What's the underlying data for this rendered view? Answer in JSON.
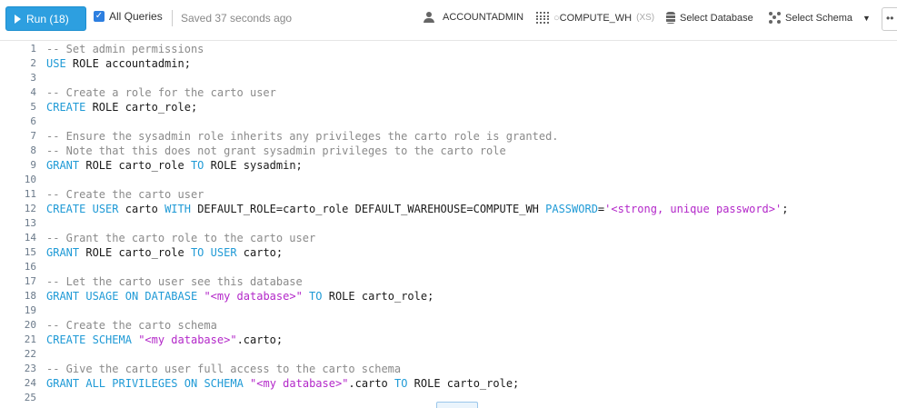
{
  "toolbar": {
    "run_label": "Run (18)",
    "all_queries_label": "All Queries",
    "all_queries_checked": true,
    "saved_text": "Saved 37 seconds ago",
    "role_label": "ACCOUNTADMIN",
    "warehouse_label": "COMPUTE_WH",
    "warehouse_size": "(XS)",
    "database_label": "Select Database",
    "schema_label": "Select Schema",
    "more_label": "••",
    "accent_color": "#2d9fe0"
  },
  "editor": {
    "lines": [
      {
        "n": "1",
        "t": [
          [
            "c",
            "-- Set admin permissions"
          ]
        ]
      },
      {
        "n": "2",
        "t": [
          [
            "k",
            "USE"
          ],
          [
            "p",
            " ROLE accountadmin;"
          ]
        ]
      },
      {
        "n": "3",
        "t": []
      },
      {
        "n": "4",
        "t": [
          [
            "c",
            "-- Create a role for the carto user"
          ]
        ]
      },
      {
        "n": "5",
        "t": [
          [
            "k",
            "CREATE"
          ],
          [
            "p",
            " ROLE carto_role;"
          ]
        ]
      },
      {
        "n": "6",
        "t": []
      },
      {
        "n": "7",
        "t": [
          [
            "c",
            "-- Ensure the sysadmin role inherits any privileges the carto role is granted."
          ]
        ]
      },
      {
        "n": "8",
        "t": [
          [
            "c",
            "-- Note that this does not grant sysadmin privileges to the carto role"
          ]
        ]
      },
      {
        "n": "9",
        "t": [
          [
            "k",
            "GRANT"
          ],
          [
            "p",
            " ROLE carto_role "
          ],
          [
            "k",
            "TO"
          ],
          [
            "p",
            " ROLE sysadmin;"
          ]
        ]
      },
      {
        "n": "10",
        "t": []
      },
      {
        "n": "11",
        "t": [
          [
            "c",
            "-- Create the carto user"
          ]
        ]
      },
      {
        "n": "12",
        "t": [
          [
            "k",
            "CREATE"
          ],
          [
            "p",
            " "
          ],
          [
            "k",
            "USER"
          ],
          [
            "p",
            " carto "
          ],
          [
            "k",
            "WITH"
          ],
          [
            "p",
            " DEFAULT_ROLE=carto_role DEFAULT_WAREHOUSE=COMPUTE_WH "
          ],
          [
            "k",
            "PASSWORD"
          ],
          [
            "p",
            "="
          ],
          [
            "s",
            "'<strong, unique password>'"
          ],
          [
            "p",
            ";"
          ]
        ]
      },
      {
        "n": "13",
        "t": []
      },
      {
        "n": "14",
        "t": [
          [
            "c",
            "-- Grant the carto role to the carto user"
          ]
        ]
      },
      {
        "n": "15",
        "t": [
          [
            "k",
            "GRANT"
          ],
          [
            "p",
            " ROLE carto_role "
          ],
          [
            "k",
            "TO"
          ],
          [
            "p",
            " "
          ],
          [
            "k",
            "USER"
          ],
          [
            "p",
            " carto;"
          ]
        ]
      },
      {
        "n": "16",
        "t": []
      },
      {
        "n": "17",
        "t": [
          [
            "c",
            "-- Let the carto user see this database"
          ]
        ]
      },
      {
        "n": "18",
        "t": [
          [
            "k",
            "GRANT"
          ],
          [
            "p",
            " "
          ],
          [
            "k",
            "USAGE"
          ],
          [
            "p",
            " "
          ],
          [
            "k",
            "ON"
          ],
          [
            "p",
            " "
          ],
          [
            "k",
            "DATABASE"
          ],
          [
            "p",
            " "
          ],
          [
            "s",
            "\"<my database>\""
          ],
          [
            "p",
            " "
          ],
          [
            "k",
            "TO"
          ],
          [
            "p",
            " ROLE carto_role;"
          ]
        ]
      },
      {
        "n": "19",
        "t": []
      },
      {
        "n": "20",
        "t": [
          [
            "c",
            "-- Create the carto schema"
          ]
        ]
      },
      {
        "n": "21",
        "t": [
          [
            "k",
            "CREATE"
          ],
          [
            "p",
            " "
          ],
          [
            "k",
            "SCHEMA"
          ],
          [
            "p",
            " "
          ],
          [
            "s",
            "\"<my database>\""
          ],
          [
            "p",
            ".carto;"
          ]
        ]
      },
      {
        "n": "22",
        "t": []
      },
      {
        "n": "23",
        "t": [
          [
            "c",
            "-- Give the carto user full access to the carto schema"
          ]
        ]
      },
      {
        "n": "24",
        "t": [
          [
            "k",
            "GRANT"
          ],
          [
            "p",
            " "
          ],
          [
            "k",
            "ALL"
          ],
          [
            "p",
            " "
          ],
          [
            "k",
            "PRIVILEGES"
          ],
          [
            "p",
            " "
          ],
          [
            "k",
            "ON"
          ],
          [
            "p",
            " "
          ],
          [
            "k",
            "SCHEMA"
          ],
          [
            "p",
            " "
          ],
          [
            "s",
            "\"<my database>\""
          ],
          [
            "p",
            ".carto "
          ],
          [
            "k",
            "TO"
          ],
          [
            "p",
            " ROLE carto_role;"
          ]
        ]
      },
      {
        "n": "25",
        "t": []
      }
    ]
  }
}
